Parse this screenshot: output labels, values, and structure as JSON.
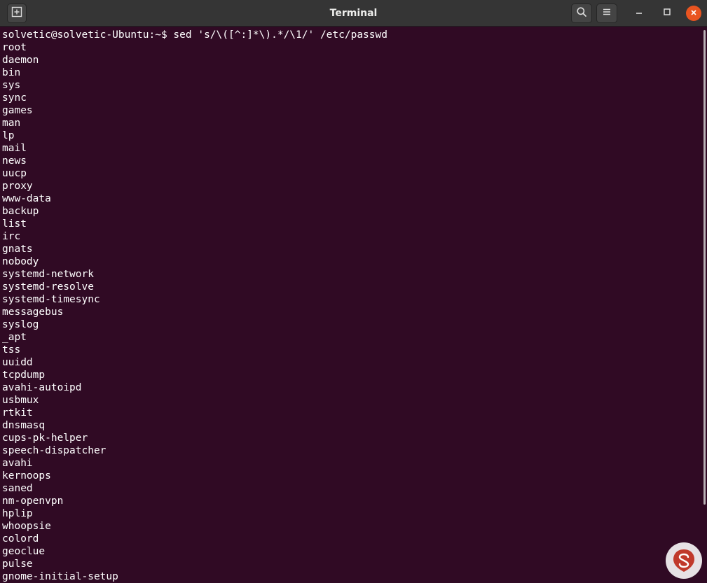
{
  "window": {
    "title": "Terminal"
  },
  "icons": {
    "new_tab": "new-tab-icon",
    "search": "search-icon",
    "menu": "hamburger-menu-icon",
    "minimize": "minimize-icon",
    "maximize": "maximize-icon",
    "close": "close-icon",
    "watermark": "solvetic-logo"
  },
  "colors": {
    "terminal_bg": "#300a24",
    "titlebar_bg": "#353535",
    "close_accent": "#e95420",
    "text": "#ffffff"
  },
  "terminal": {
    "lines": [
      "solvetic@solvetic-Ubuntu:~$ sed 's/\\([^:]*\\).*/\\1/' /etc/passwd",
      "root",
      "daemon",
      "bin",
      "sys",
      "sync",
      "games",
      "man",
      "lp",
      "mail",
      "news",
      "uucp",
      "proxy",
      "www-data",
      "backup",
      "list",
      "irc",
      "gnats",
      "nobody",
      "systemd-network",
      "systemd-resolve",
      "systemd-timesync",
      "messagebus",
      "syslog",
      "_apt",
      "tss",
      "uuidd",
      "tcpdump",
      "avahi-autoipd",
      "usbmux",
      "rtkit",
      "dnsmasq",
      "cups-pk-helper",
      "speech-dispatcher",
      "avahi",
      "kernoops",
      "saned",
      "nm-openvpn",
      "hplip",
      "whoopsie",
      "colord",
      "geoclue",
      "pulse",
      "gnome-initial-setup"
    ]
  }
}
